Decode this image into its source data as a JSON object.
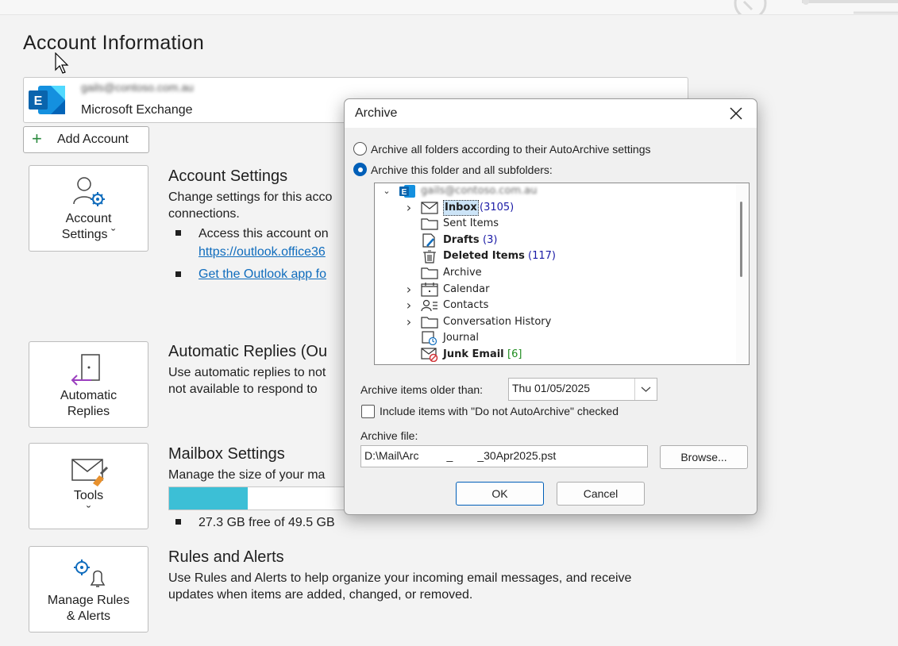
{
  "page": {
    "title": "Account Information"
  },
  "account": {
    "email": "gails@contoso.com.au",
    "type": "Microsoft Exchange",
    "add_account_label": "Add Account"
  },
  "sections": {
    "account_settings": {
      "tile_label_1": "Account",
      "tile_label_2": "Settings ˇ",
      "title": "Account Settings",
      "desc_1": "Change settings for this acco",
      "desc_2": "connections.",
      "bullet_1": "Access this account on",
      "link_1": "https://outlook.office36",
      "link_2": "Get the Outlook app fo"
    },
    "automatic_replies": {
      "tile_label_1": "Automatic",
      "tile_label_2": "Replies",
      "title": "Automatic Replies (Ou",
      "desc_1": "Use automatic replies to not",
      "desc_2": "not available to respond to"
    },
    "mailbox_settings": {
      "tile_label_1": "Tools",
      "tile_label_2": "ˇ",
      "title": "Mailbox Settings",
      "desc_1": "Manage the size of your ma",
      "storage_free": "27.3 GB free of 49.5 GB",
      "used_fraction": 0.45
    },
    "rules_alerts": {
      "tile_label_1": "Manage Rules",
      "tile_label_2": "& Alerts",
      "title": "Rules and Alerts",
      "desc_1": "Use Rules and Alerts to help organize your incoming email messages, and receive",
      "desc_2": "updates when items are added, changed, or removed."
    }
  },
  "dialog": {
    "title": "Archive",
    "radio_all": "Archive all folders according to their AutoArchive settings",
    "radio_this": "Archive this folder and all subfolders:",
    "selected_radio": "radio_this",
    "tree": {
      "root": "gails@contoso.com.au",
      "items": [
        {
          "name": "Inbox",
          "count": "(3105)",
          "expandable": true,
          "bold": true,
          "selected": true,
          "icon": "inbox-icon"
        },
        {
          "name": "Sent Items",
          "count": "",
          "expandable": false,
          "bold": false,
          "icon": "folder-icon"
        },
        {
          "name": "Drafts",
          "count": "(3)",
          "expandable": false,
          "bold": true,
          "icon": "drafts-icon"
        },
        {
          "name": "Deleted Items",
          "count": "(117)",
          "expandable": false,
          "bold": true,
          "icon": "trash-icon"
        },
        {
          "name": "Archive",
          "count": "",
          "expandable": false,
          "bold": false,
          "icon": "folder-icon"
        },
        {
          "name": "Calendar",
          "count": "",
          "expandable": true,
          "bold": false,
          "icon": "calendar-icon"
        },
        {
          "name": "Contacts",
          "count": "",
          "expandable": true,
          "bold": false,
          "icon": "contacts-icon"
        },
        {
          "name": "Conversation History",
          "count": "",
          "expandable": true,
          "bold": false,
          "icon": "folder-icon"
        },
        {
          "name": "Journal",
          "count": "",
          "expandable": false,
          "bold": false,
          "icon": "journal-icon"
        },
        {
          "name": "Junk Email",
          "count": "[6]",
          "expandable": false,
          "bold": true,
          "icon": "junk-icon"
        }
      ]
    },
    "older_than_label": "Archive items older than:",
    "older_than_value": "Thu 01/05/2025",
    "include_label": "Include items with \"Do not AutoArchive\" checked",
    "archive_file_label": "Archive file:",
    "archive_file_value": "D:\\Mail\\Arc         _        _30Apr2025.pst",
    "browse_label": "Browse...",
    "ok_label": "OK",
    "cancel_label": "Cancel"
  },
  "colors": {
    "exchange_blue": "#0a64ad",
    "link": "#0f6cbd",
    "storage_fill": "#3cbfd6",
    "radio_selected": "#005fb8"
  }
}
